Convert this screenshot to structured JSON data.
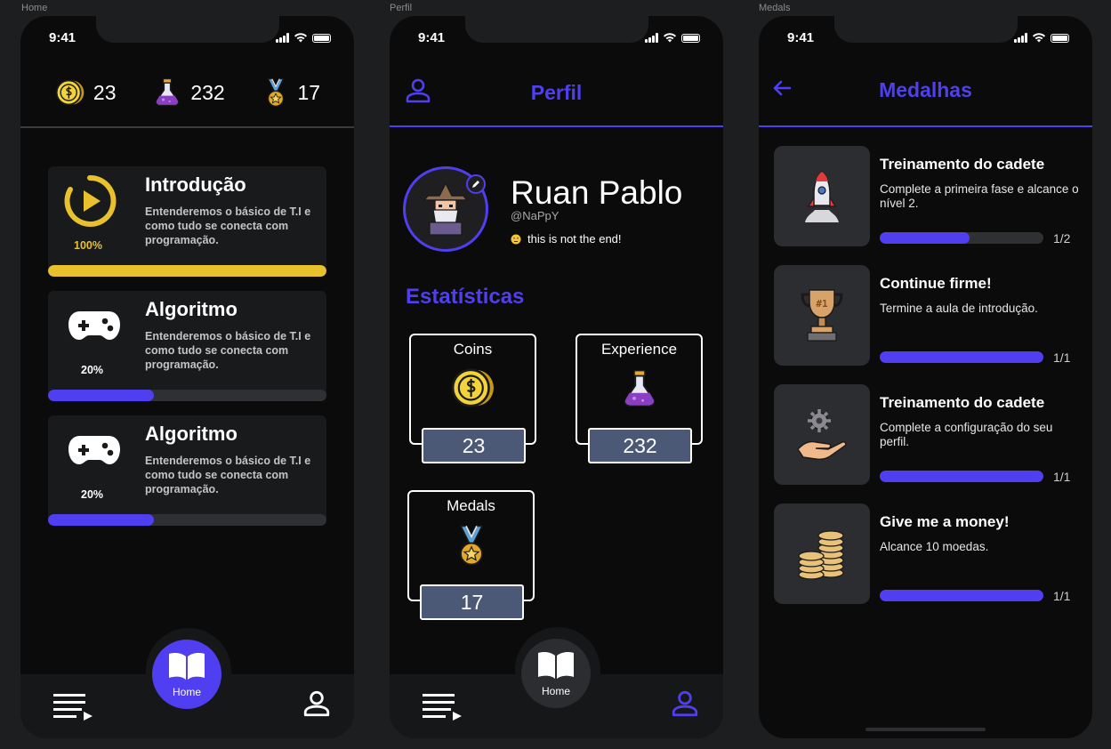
{
  "frames": [
    "Home",
    "Perfil",
    "Medals"
  ],
  "status": {
    "time": "9:41"
  },
  "colors": {
    "accent": "#4f3ff0",
    "gold": "#e8c12d",
    "card": "#191a1c",
    "track": "#2e3033"
  },
  "home": {
    "stats": {
      "coins": "23",
      "experience": "232",
      "medals": "17"
    },
    "cards": [
      {
        "title": "Introdução",
        "desc": "Entenderemos o básico de T.I e como tudo se conecta com programação.",
        "pct_label": "100%",
        "progress": 1.0,
        "icon": "play-circle-icon"
      },
      {
        "title": "Algoritmo",
        "desc": "Entenderemos o básico de T.I e como tudo se conecta com programação.",
        "pct_label": "20%",
        "progress": 0.38,
        "icon": "gamepad-icon"
      },
      {
        "title": "Algoritmo",
        "desc": "Entenderemos o básico de T.I e como tudo se conecta com programação.",
        "pct_label": "20%",
        "progress": 0.38,
        "icon": "gamepad-icon"
      }
    ],
    "tab_home_label": "Home"
  },
  "perfil": {
    "title": "Perfil",
    "name": "Ruan Pablo",
    "handle": "@NaPpY",
    "bio": "this is not the end!",
    "section_title": "Estatísticas",
    "boxes": {
      "coins": {
        "label": "Coins",
        "value": "23"
      },
      "experience": {
        "label": "Experience",
        "value": "232"
      },
      "medals": {
        "label": "Medals",
        "value": "17"
      }
    },
    "tab_home_label": "Home"
  },
  "medals": {
    "title": "Medalhas",
    "items": [
      {
        "title": "Treinamento do cadete",
        "desc": "Complete  a primeira fase e alcance o nível 2.",
        "count": "1/2",
        "progress": 0.55,
        "icon": "rocket-icon"
      },
      {
        "title": "Continue firme!",
        "desc": "Termine a aula de introdução.",
        "count": "1/1",
        "progress": 1.0,
        "icon": "trophy-icon"
      },
      {
        "title": "Treinamento do cadete",
        "desc": "Complete a configuração do seu perfil.",
        "count": "1/1",
        "progress": 1.0,
        "icon": "gear-hand-icon"
      },
      {
        "title": "Give me a money!",
        "desc": "Alcance 10 moedas.",
        "count": "1/1",
        "progress": 1.0,
        "icon": "coin-stack-icon"
      }
    ],
    "trophy_text": "#1"
  }
}
